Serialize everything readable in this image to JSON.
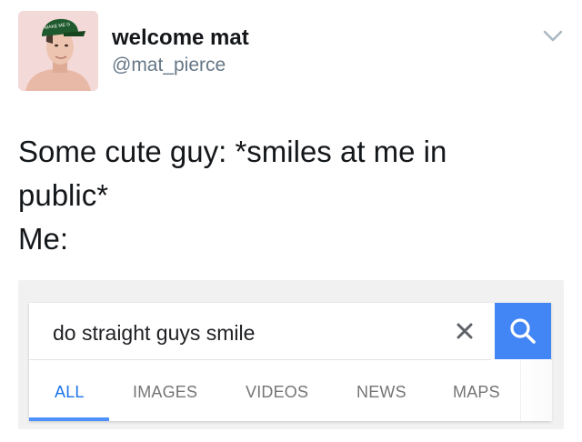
{
  "tweet": {
    "display_name": "welcome mat",
    "handle": "@mat_pierce",
    "avatar_icon": "profile-photo",
    "hat_text": "MAKE ME G",
    "text_lines": [
      "Some cute guy: *smiles at me in",
      "public*",
      "Me:"
    ]
  },
  "search": {
    "query": "do straight guys smile",
    "clear_icon": "close-icon",
    "search_icon": "search-icon",
    "accent_color": "#4285f4"
  },
  "tabs": [
    {
      "label": "ALL",
      "active": true
    },
    {
      "label": "IMAGES",
      "active": false
    },
    {
      "label": "VIDEOS",
      "active": false
    },
    {
      "label": "NEWS",
      "active": false
    },
    {
      "label": "MAPS",
      "active": false
    }
  ]
}
